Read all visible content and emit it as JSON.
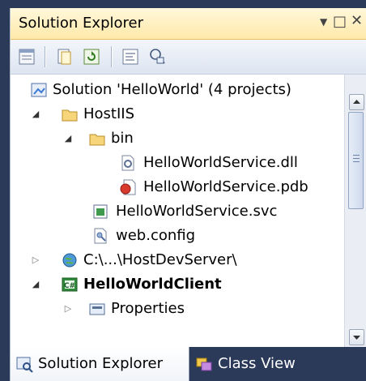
{
  "panel": {
    "title": "Solution Explorer",
    "controls": {
      "dropdown": "▼",
      "maximize": "□",
      "close": "✕"
    }
  },
  "toolbar": {
    "buttons": [
      {
        "name": "properties-icon"
      },
      {
        "name": "show-all-files-icon"
      },
      {
        "name": "refresh-icon"
      },
      {
        "name": "view-code-icon"
      },
      {
        "name": "view-class-diagram-icon"
      }
    ]
  },
  "tree": {
    "items": [
      {
        "label": "Solution 'HelloWorld' (4 projects)",
        "icon": "solution-icon",
        "expander": ""
      },
      {
        "label": "HostIIS",
        "icon": "folder-icon",
        "expander": "expanded"
      },
      {
        "label": "bin",
        "icon": "folder-icon",
        "expander": "expanded"
      },
      {
        "label": "HelloWorldService.dll",
        "icon": "dll-file-icon",
        "expander": ""
      },
      {
        "label": "HelloWorldService.pdb",
        "icon": "pdb-file-icon",
        "expander": ""
      },
      {
        "label": "HelloWorldService.svc",
        "icon": "svc-file-icon",
        "expander": ""
      },
      {
        "label": "web.config",
        "icon": "config-file-icon",
        "expander": ""
      },
      {
        "label": "C:\\...\\HostDevServer\\",
        "icon": "web-project-icon",
        "expander": "collapsed"
      },
      {
        "label": "HelloWorldClient",
        "icon": "csharp-project-icon",
        "expander": "expanded"
      },
      {
        "label": "Properties",
        "icon": "properties-folder-icon",
        "expander": "collapsed"
      }
    ]
  },
  "tabs": [
    {
      "label": "Solution Explorer",
      "icon": "solution-explorer-icon",
      "active": true
    },
    {
      "label": "Class View",
      "icon": "class-view-icon",
      "active": false
    }
  ],
  "colors": {
    "tab_bar": "#2b3a58",
    "title_bar": "#ffe9a9",
    "selection_accent": "#3399ff"
  }
}
